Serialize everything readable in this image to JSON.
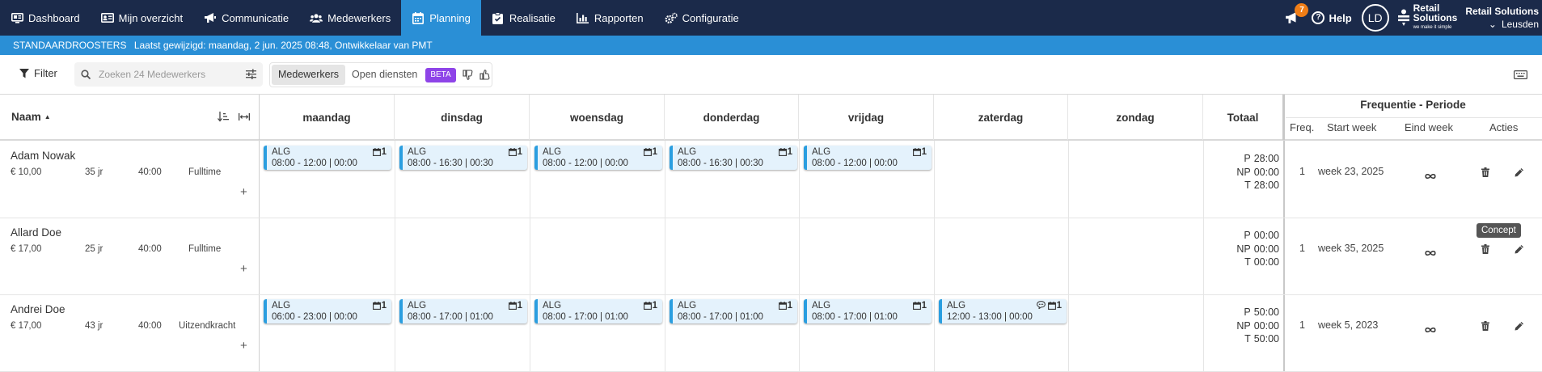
{
  "nav": {
    "items": [
      {
        "label": "Dashboard",
        "icon": "dashboard-icon"
      },
      {
        "label": "Mijn overzicht",
        "icon": "id-card-icon"
      },
      {
        "label": "Communicatie",
        "icon": "megaphone-icon"
      },
      {
        "label": "Medewerkers",
        "icon": "users-icon"
      },
      {
        "label": "Planning",
        "icon": "calendar-icon",
        "active": true
      },
      {
        "label": "Realisatie",
        "icon": "clipboard-icon"
      },
      {
        "label": "Rapporten",
        "icon": "chart-icon"
      },
      {
        "label": "Configuratie",
        "icon": "gears-icon"
      }
    ],
    "notifications": "7",
    "help": "Help",
    "user_initials": "LD",
    "brand_line1": "Retail",
    "brand_line2": "Solutions",
    "brand_tagline": "we make it simple",
    "company": "Retail Solutions",
    "location": "Leusden"
  },
  "infobar": {
    "title": "Standaardroosters",
    "text": "Laatst gewijzigd: maandag, 2 jun. 2025 08:48, Ontwikkelaar van PMT"
  },
  "toolbar": {
    "filter": "Filter",
    "search_placeholder": "Zoeken 24 Medewerkers",
    "view_employees": "Medewerkers",
    "view_open": "Open diensten",
    "beta": "BETA"
  },
  "header": {
    "naam": "Naam",
    "days": [
      "maandag",
      "dinsdag",
      "woensdag",
      "donderdag",
      "vrijdag",
      "zaterdag",
      "zondag"
    ],
    "totaal": "Totaal",
    "freq_title": "Frequentie - Periode",
    "freq": "Freq.",
    "start": "Start week",
    "end": "Eind week",
    "actions": "Acties"
  },
  "rows": [
    {
      "name": "Adam Nowak",
      "wage": "€ 10,00",
      "age": "35 jr",
      "hours": "40:00",
      "contract": "Fulltime",
      "shifts": [
        {
          "day": "maandag",
          "code": "ALG",
          "time": "08:00 - 12:00 | 00:00",
          "count": "1"
        },
        {
          "day": "dinsdag",
          "code": "ALG",
          "time": "08:00 - 16:30 | 00:30",
          "count": "1"
        },
        {
          "day": "woensdag",
          "code": "ALG",
          "time": "08:00 - 12:00 | 00:00",
          "count": "1"
        },
        {
          "day": "donderdag",
          "code": "ALG",
          "time": "08:00 - 16:30 | 00:30",
          "count": "1"
        },
        {
          "day": "vrijdag",
          "code": "ALG",
          "time": "08:00 - 12:00 | 00:00",
          "count": "1"
        }
      ],
      "totals": {
        "P": "28:00",
        "NP": "00:00",
        "T": "28:00"
      },
      "freq": "1",
      "start_week": "week 23, 2025"
    },
    {
      "name": "Allard Doe",
      "wage": "€ 17,00",
      "age": "25 jr",
      "hours": "40:00",
      "contract": "Fulltime",
      "shifts": [],
      "totals": {
        "P": "00:00",
        "NP": "00:00",
        "T": "00:00"
      },
      "freq": "1",
      "start_week": "week 35, 2025"
    },
    {
      "name": "Andrei Doe",
      "wage": "€ 17,00",
      "age": "43 jr",
      "hours": "40:00",
      "contract": "Uitzendkracht",
      "shifts": [
        {
          "day": "maandag",
          "code": "ALG",
          "time": "06:00 - 23:00 | 00:00",
          "count": "1"
        },
        {
          "day": "dinsdag",
          "code": "ALG",
          "time": "08:00 - 17:00 | 01:00",
          "count": "1"
        },
        {
          "day": "woensdag",
          "code": "ALG",
          "time": "08:00 - 17:00 | 01:00",
          "count": "1"
        },
        {
          "day": "donderdag",
          "code": "ALG",
          "time": "08:00 - 17:00 | 01:00",
          "count": "1"
        },
        {
          "day": "vrijdag",
          "code": "ALG",
          "time": "08:00 - 17:00 | 01:00",
          "count": "1"
        },
        {
          "day": "zaterdag",
          "code": "ALG",
          "time": "12:00 - 13:00 | 00:00",
          "count": "1",
          "comment": true
        }
      ],
      "totals": {
        "P": "50:00",
        "NP": "00:00",
        "T": "50:00"
      },
      "freq": "1",
      "start_week": "week 5, 2023"
    }
  ],
  "tooltip": "Concept",
  "colors": {
    "nav_bg": "#1b2a4a",
    "accent": "#2a8fd6",
    "shift_bg": "#e4f2fc",
    "shift_border": "#2a9ee0",
    "beta": "#8e44e8",
    "badge": "#ef7d17"
  }
}
